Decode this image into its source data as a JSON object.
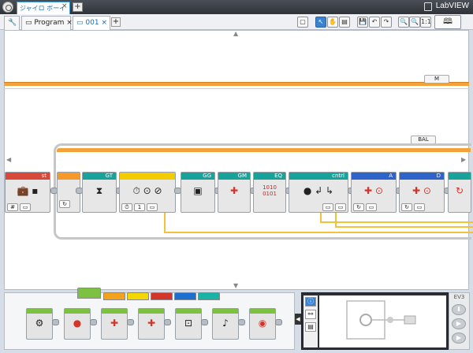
{
  "project_tab": {
    "title": "ジャイロ ボーイ",
    "close": "×",
    "add": "+"
  },
  "brand": "LabVIEW",
  "program_tabs": [
    {
      "label": "Program",
      "close": "×"
    },
    {
      "label": "001",
      "close": "×"
    }
  ],
  "add_tab": "+",
  "toolbar_buttons": [
    {
      "name": "comment-button",
      "glyph": "▢"
    },
    {
      "name": "select-tool-button",
      "glyph": "↖"
    },
    {
      "name": "pan-tool-button",
      "glyph": "✋"
    },
    {
      "name": "comment-tool-button",
      "glyph": "▤"
    },
    {
      "name": "save-button",
      "glyph": "💾"
    },
    {
      "name": "undo-button",
      "glyph": "↶"
    },
    {
      "name": "redo-button",
      "glyph": "↷"
    },
    {
      "name": "zoom-out-button",
      "glyph": "🔍"
    },
    {
      "name": "zoom-in-button",
      "glyph": "🔍"
    },
    {
      "name": "zoom-reset-button",
      "glyph": "1:1"
    }
  ],
  "help_button": "🕮",
  "canvas": {
    "sequence_tags": {
      "top": "M",
      "loop": "BAL"
    },
    "blocks": [
      {
        "name": "st",
        "label": "st",
        "color": "red"
      },
      {
        "name": "gt",
        "label": "GT",
        "color": "teal"
      },
      {
        "name": "timer",
        "label": "",
        "color": "yellow"
      },
      {
        "name": "gg",
        "label": "GG",
        "color": "teal"
      },
      {
        "name": "gm",
        "label": "GM",
        "color": "teal"
      },
      {
        "name": "eq",
        "label": "EQ",
        "color": "teal",
        "icon_text": "1010\n0101"
      },
      {
        "name": "cntrl",
        "label": "cntrl",
        "color": "teal"
      },
      {
        "name": "motor-a",
        "label": "A",
        "color": "blue"
      },
      {
        "name": "motor-d",
        "label": "D",
        "color": "blue"
      }
    ],
    "timer_value": "1"
  },
  "palette": {
    "tabs": [
      {
        "name": "action",
        "color": "#7cc142"
      },
      {
        "name": "flow",
        "color": "#f3a21e"
      },
      {
        "name": "sensor",
        "color": "#f2d800"
      },
      {
        "name": "data",
        "color": "#d3352b"
      },
      {
        "name": "advanced",
        "color": "#1c6fd1"
      },
      {
        "name": "myblocks",
        "color": "#19b3a5"
      }
    ],
    "blocks": [
      {
        "name": "medium-motor",
        "glyph": "⚙"
      },
      {
        "name": "large-motor",
        "glyph": "●"
      },
      {
        "name": "move-steering",
        "glyph": "✚"
      },
      {
        "name": "move-tank",
        "glyph": "✚"
      },
      {
        "name": "display",
        "glyph": "⊡"
      },
      {
        "name": "sound",
        "glyph": "♪"
      },
      {
        "name": "brick-status-light",
        "glyph": "◉"
      }
    ]
  },
  "ev3_label": "EV3"
}
